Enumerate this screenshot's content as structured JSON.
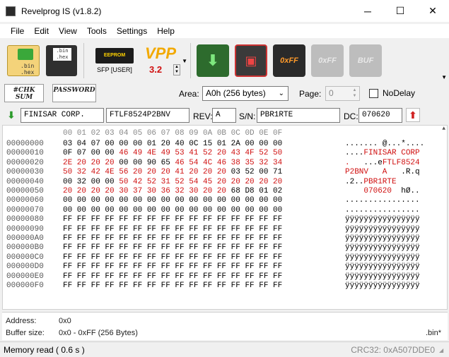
{
  "window": {
    "title": "Revelprog IS (v1.8.2)",
    "minimize": "─",
    "maximize": "☐",
    "close": "✕"
  },
  "menu": [
    "File",
    "Edit",
    "View",
    "Tools",
    "Settings",
    "Help"
  ],
  "toolbar": {
    "open_label": ".bin .hex",
    "save_label": ".bin .hex",
    "chip_text": "EEPROM",
    "chip_device": "SFP [USER]",
    "vpp_text": "VPP",
    "vpp_value": "3.2",
    "erase_text": "0xFF",
    "blank_text": "0xFF",
    "buf_text": "BUF"
  },
  "options": {
    "chksum_text": "#CHK SUM",
    "password_text": "PASSWORD",
    "area_label": "Area:",
    "area_value": "A0h (256 bytes)",
    "page_label": "Page:",
    "page_value": "0",
    "nodelay_label": "NoDelay"
  },
  "info": {
    "vendor": "FINISAR CORP.",
    "part": "FTLF8524P2BNV",
    "rev_label": "REV:",
    "rev": "A",
    "sn_label": "S/N:",
    "sn": "PBR1RTE",
    "dc_label": "DC:",
    "dc": "070620"
  },
  "hex": {
    "header": "00 01 02 03 04 05 06 07 08 09 0A 0B 0C 0D 0E 0F",
    "rows": [
      {
        "addr": "00000000",
        "bytes": [
          [
            "03 04 07 00 00 00 01 20 40 0C 15 01 2A 00 00 00",
            ""
          ]
        ],
        "ascii": [
          [
            ".......",
            ""
          ],
          [
            " @...*....",
            ""
          ]
        ]
      },
      {
        "addr": "00000010",
        "bytes": [
          [
            "0F 07 00 00 ",
            ""
          ],
          [
            "46 49 4E 49 53 41 52 20 43 4F 52 50",
            "red"
          ]
        ],
        "ascii": [
          [
            "....",
            ""
          ],
          [
            "FINISAR CORP",
            "red"
          ]
        ]
      },
      {
        "addr": "00000020",
        "bytes": [
          [
            "2E 20 20 20 ",
            "red"
          ],
          [
            "00 00 90 65 ",
            ""
          ],
          [
            "46 54 4C 46 38 35 32 34",
            "red"
          ]
        ],
        "ascii": [
          [
            ".   ",
            "red"
          ],
          [
            "...e",
            ""
          ],
          [
            "FTLF8524",
            "red"
          ]
        ]
      },
      {
        "addr": "00000030",
        "bytes": [
          [
            "50 32 42 4E 56 20 20 20 41 20 20 20 ",
            "red"
          ],
          [
            "03 52 00 71",
            ""
          ]
        ],
        "ascii": [
          [
            "P2BNV   A   ",
            "red"
          ],
          [
            ".R.q",
            ""
          ]
        ]
      },
      {
        "addr": "00000040",
        "bytes": [
          [
            "00 32 00 00 ",
            ""
          ],
          [
            "50 42 52 31 52 54 45 20 20 20 20 20",
            "red"
          ]
        ],
        "ascii": [
          [
            ".2..",
            ""
          ],
          [
            "PBR1RTE     ",
            "red"
          ]
        ]
      },
      {
        "addr": "00000050",
        "bytes": [
          [
            "20 20 20 20 30 37 30 36 32 30 20 20 ",
            "red"
          ],
          [
            "68 D8 01 02",
            ""
          ]
        ],
        "ascii": [
          [
            "    070620  ",
            "red"
          ],
          [
            "hØ..",
            ""
          ]
        ]
      },
      {
        "addr": "00000060",
        "bytes": [
          [
            "00 00 00 00 00 00 00 00 00 00 00 00 00 00 00 00",
            ""
          ]
        ],
        "ascii": [
          [
            "................",
            ""
          ]
        ]
      },
      {
        "addr": "00000070",
        "bytes": [
          [
            "00 00 00 00 00 00 00 00 00 00 00 00 00 00 00 00",
            ""
          ]
        ],
        "ascii": [
          [
            "................",
            ""
          ]
        ]
      },
      {
        "addr": "00000080",
        "bytes": [
          [
            "FF FF FF FF FF FF FF FF FF FF FF FF FF FF FF FF",
            ""
          ]
        ],
        "ascii": [
          [
            "ÿÿÿÿÿÿÿÿÿÿÿÿÿÿÿÿ",
            ""
          ]
        ]
      },
      {
        "addr": "00000090",
        "bytes": [
          [
            "FF FF FF FF FF FF FF FF FF FF FF FF FF FF FF FF",
            ""
          ]
        ],
        "ascii": [
          [
            "ÿÿÿÿÿÿÿÿÿÿÿÿÿÿÿÿ",
            ""
          ]
        ]
      },
      {
        "addr": "000000A0",
        "bytes": [
          [
            "FF FF FF FF FF FF FF FF FF FF FF FF FF FF FF FF",
            ""
          ]
        ],
        "ascii": [
          [
            "ÿÿÿÿÿÿÿÿÿÿÿÿÿÿÿÿ",
            ""
          ]
        ]
      },
      {
        "addr": "000000B0",
        "bytes": [
          [
            "FF FF FF FF FF FF FF FF FF FF FF FF FF FF FF FF",
            ""
          ]
        ],
        "ascii": [
          [
            "ÿÿÿÿÿÿÿÿÿÿÿÿÿÿÿÿ",
            ""
          ]
        ]
      },
      {
        "addr": "000000C0",
        "bytes": [
          [
            "FF FF FF FF FF FF FF FF FF FF FF FF FF FF FF FF",
            ""
          ]
        ],
        "ascii": [
          [
            "ÿÿÿÿÿÿÿÿÿÿÿÿÿÿÿÿ",
            ""
          ]
        ]
      },
      {
        "addr": "000000D0",
        "bytes": [
          [
            "FF FF FF FF FF FF FF FF FF FF FF FF FF FF FF FF",
            ""
          ]
        ],
        "ascii": [
          [
            "ÿÿÿÿÿÿÿÿÿÿÿÿÿÿÿÿ",
            ""
          ]
        ]
      },
      {
        "addr": "000000E0",
        "bytes": [
          [
            "FF FF FF FF FF FF FF FF FF FF FF FF FF FF FF FF",
            ""
          ]
        ],
        "ascii": [
          [
            "ÿÿÿÿÿÿÿÿÿÿÿÿÿÿÿÿ",
            ""
          ]
        ]
      },
      {
        "addr": "000000F0",
        "bytes": [
          [
            "FF FF FF FF FF FF FF FF FF FF FF FF FF FF FF FF",
            ""
          ]
        ],
        "ascii": [
          [
            "ÿÿÿÿÿÿÿÿÿÿÿÿÿÿÿÿ",
            ""
          ]
        ]
      }
    ]
  },
  "footer": {
    "address_label": "Address:",
    "address_value": "0x0",
    "buffer_label": "Buffer size:",
    "buffer_value": "0x0 - 0xFF (256 Bytes)",
    "file_ext": ".bin*"
  },
  "status": {
    "message": "Memory read ( 0.6 s )",
    "crc": "CRC32: 0xA507DDE0"
  },
  "colors": {
    "accent_red": "#d01010",
    "read_green": "#2d6b2d"
  }
}
